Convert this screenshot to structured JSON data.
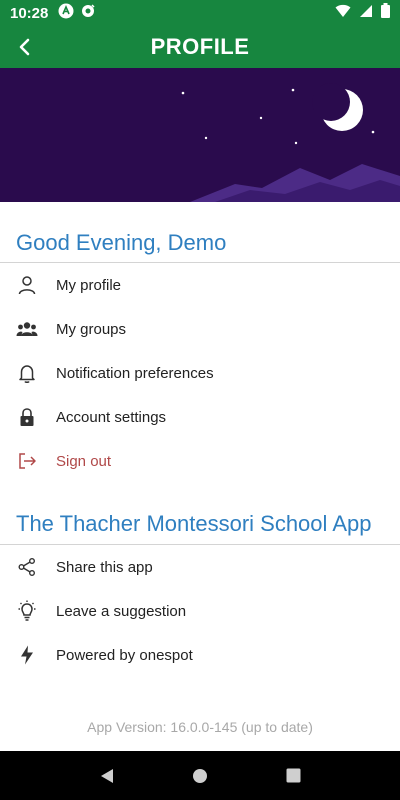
{
  "status_bar": {
    "time": "10:28",
    "left_icons": [
      "app-a-icon",
      "notification-icon"
    ],
    "right_icons": [
      "wifi-icon",
      "signal-icon",
      "battery-icon"
    ]
  },
  "app_bar": {
    "title": "PROFILE",
    "back_icon": "back-arrow-icon",
    "color": "#17863f"
  },
  "hero": {
    "sky_color": "#2a0b4d",
    "mountain_color": "#4c2b86",
    "icons": [
      "moon-icon",
      "star-icon"
    ]
  },
  "greeting_section": {
    "title": "Good Evening, Demo",
    "items": [
      {
        "label": "My profile",
        "icon": "person-icon"
      },
      {
        "label": "My groups",
        "icon": "group-icon"
      },
      {
        "label": "Notification preferences",
        "icon": "bell-icon"
      },
      {
        "label": "Account settings",
        "icon": "lock-icon"
      },
      {
        "label": "Sign out",
        "icon": "sign-out-icon"
      }
    ]
  },
  "app_section": {
    "title": "The Thacher Montessori School App",
    "items": [
      {
        "label": "Share this app",
        "icon": "share-icon"
      },
      {
        "label": "Leave a suggestion",
        "icon": "lightbulb-icon"
      },
      {
        "label": "Powered by onespot",
        "icon": "lightning-icon"
      }
    ]
  },
  "app_version": "App Version: 16.0.0-145 (up to date)",
  "nav_bar": {
    "buttons": [
      "back-triangle-icon",
      "home-circle-icon",
      "recents-square-icon"
    ]
  },
  "colors": {
    "accent": "#2f7fc0",
    "danger": "#b04848",
    "primary": "#17863f"
  }
}
